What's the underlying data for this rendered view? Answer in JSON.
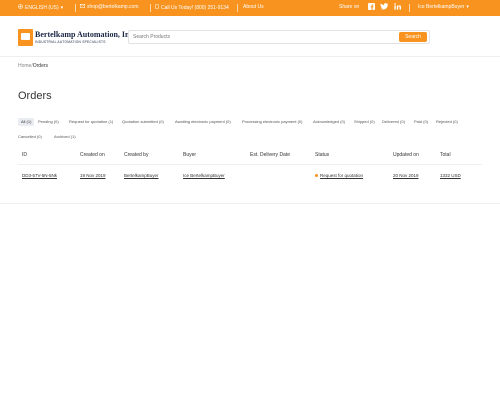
{
  "topbar": {
    "language": "ENGLISH (US)",
    "email": "shop@bertelkamp.com",
    "phone": "Call Us Today! (800) 251-9134",
    "about": "About Us",
    "share_label": "Share on",
    "social": [
      "facebook-icon",
      "twitter-icon",
      "linkedin-icon"
    ],
    "user_menu": "Ice BertelkampBuyer"
  },
  "header": {
    "logo_name": "Bertelkamp Automation, Inc.",
    "logo_tagline": "INDUSTRIAL AUTOMATION SPECIALISTS",
    "search_placeholder": "Search Products",
    "search_button": "Search"
  },
  "breadcrumb": {
    "home": "Home",
    "separator": "/",
    "current": "Orders"
  },
  "page_title": "Orders",
  "tabs": [
    "All (1)",
    "Pending (0)",
    "Request for quotation (1)",
    "Quotation submitted (0)",
    "Awaiting electronic payment (0)",
    "Processing electronic payment (0)",
    "Acknowledged (0)",
    "Shipped (0)",
    "Delivered (0)",
    "Paid (0)",
    "Rejected (0)",
    "Cancelled (0)",
    "Archived (1)"
  ],
  "table": {
    "headers": [
      "ID",
      "Created on",
      "Created by",
      "Buyer",
      "Est. Delivery Date",
      "Status",
      "Updated on",
      "Total"
    ],
    "rows": [
      {
        "id": "DD3-57V-5N-5Nk",
        "created_on": "19 Nov 2019",
        "created_by": "BertelkampBuyer",
        "buyer": "Ice BertelkampBuyer",
        "est_delivery": "",
        "status": "Request for quotation",
        "updated_on": "20 Nov 2019",
        "total": "1332 USD"
      }
    ]
  },
  "colors": {
    "accent": "#f7931e",
    "navy": "#1a2744"
  }
}
